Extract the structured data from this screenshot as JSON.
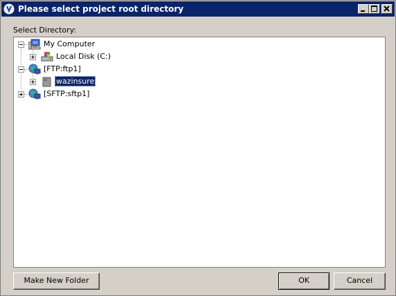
{
  "window": {
    "title": "Please select project root directory",
    "title_bar_color": "#0a246a"
  },
  "labels": {
    "select_directory": "Select Directory:"
  },
  "tree": {
    "nodes": [
      {
        "label": "My Computer",
        "icon": "computer-icon",
        "expanded": true
      },
      {
        "label": "Local Disk (C:)",
        "icon": "drive-icon",
        "expanded": false
      },
      {
        "label": "[FTP:ftp1]",
        "icon": "network-globe-icon",
        "expanded": true
      },
      {
        "label": "wazinsure",
        "icon": "server-folder-icon",
        "expanded": false,
        "selected": true
      },
      {
        "label": "[SFTP:sftp1]",
        "icon": "network-globe-icon",
        "expanded": false
      }
    ],
    "selection_color": "#0a246a"
  },
  "buttons": {
    "make_new_folder": "Make New Folder",
    "ok": "OK",
    "cancel": "Cancel"
  }
}
